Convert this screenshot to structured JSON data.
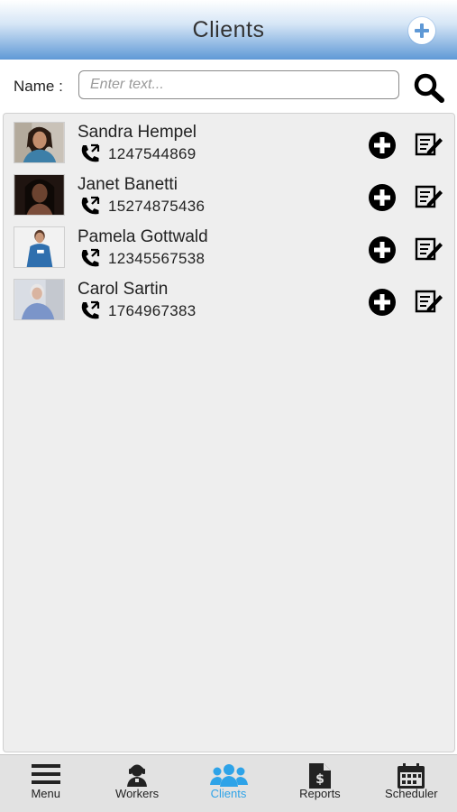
{
  "header": {
    "title": "Clients",
    "add_icon": "plus-circle-icon"
  },
  "search": {
    "label": "Name :",
    "placeholder": "Enter text...",
    "value": "",
    "icon": "search-icon"
  },
  "clients": [
    {
      "name": "Sandra Hempel",
      "phone": "1247544869"
    },
    {
      "name": "Janet Banetti",
      "phone": "15274875436"
    },
    {
      "name": "Pamela Gottwald",
      "phone": "12345567538"
    },
    {
      "name": "Carol Sartin",
      "phone": "1764967383"
    }
  ],
  "tabs": [
    {
      "label": "Menu",
      "icon": "menu-icon",
      "active": false
    },
    {
      "label": "Workers",
      "icon": "worker-icon",
      "active": false
    },
    {
      "label": "Clients",
      "icon": "users-icon",
      "active": true
    },
    {
      "label": "Reports",
      "icon": "report-icon",
      "active": false
    },
    {
      "label": "Scheduler",
      "icon": "calendar-icon",
      "active": false
    }
  ],
  "colors": {
    "header_blue": "#5f99d6",
    "active_tab": "#2ea3e8",
    "panel_bg": "#eeeeee"
  }
}
